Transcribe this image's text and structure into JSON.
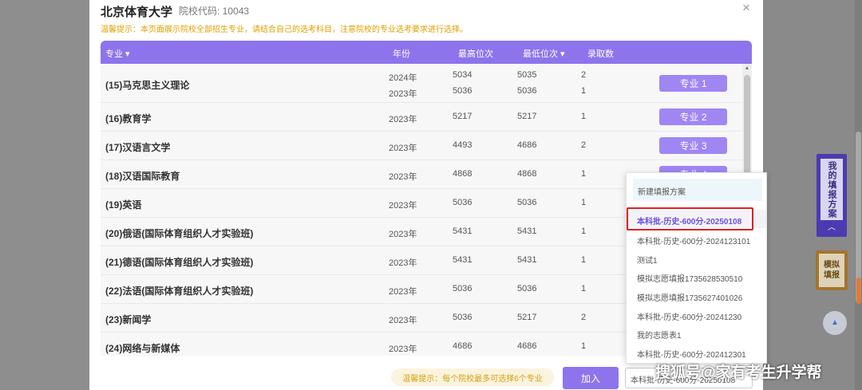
{
  "school": {
    "name": "北京体育大学",
    "code_label": "院校代码: 10043"
  },
  "notice": "温馨提示：本页面展示院校全部招生专业，请结合自己的选考科目，注意院校的专业选考要求进行选择。",
  "close_icon": "×",
  "table": {
    "headers": [
      "专业 ▾",
      "年份",
      "最高位次",
      "最低位次 ▾",
      "录取数"
    ],
    "rows": [
      {
        "major": "(15)马克思主义理论",
        "entries": [
          {
            "year": "2024年",
            "high": "5034",
            "low": "5035",
            "count": "2"
          },
          {
            "year": "2023年",
            "high": "5036",
            "low": "5036",
            "count": "1"
          }
        ],
        "button": "专业 1"
      },
      {
        "major": "(16)教育学",
        "entries": [
          {
            "year": "2023年",
            "high": "5217",
            "low": "5217",
            "count": "1"
          }
        ],
        "button": "专业 2"
      },
      {
        "major": "(17)汉语言文学",
        "entries": [
          {
            "year": "2023年",
            "high": "4493",
            "low": "4686",
            "count": "2"
          }
        ],
        "button": "专业 3"
      },
      {
        "major": "(18)汉语国际教育",
        "entries": [
          {
            "year": "2023年",
            "high": "4868",
            "low": "4868",
            "count": "1"
          }
        ],
        "button": "专业 4"
      },
      {
        "major": "(19)英语",
        "entries": [
          {
            "year": "2023年",
            "high": "5036",
            "low": "5036",
            "count": "1"
          }
        ],
        "button": ""
      },
      {
        "major": "(20)俄语(国际体育组织人才实验班)",
        "entries": [
          {
            "year": "2023年",
            "high": "5431",
            "low": "5431",
            "count": "1"
          }
        ],
        "button": ""
      },
      {
        "major": "(21)德语(国际体育组织人才实验班)",
        "entries": [
          {
            "year": "2023年",
            "high": "5431",
            "low": "5431",
            "count": "1"
          }
        ],
        "button": ""
      },
      {
        "major": "(22)法语(国际体育组织人才实验班)",
        "entries": [
          {
            "year": "2023年",
            "high": "5036",
            "low": "5036",
            "count": "1"
          }
        ],
        "button": ""
      },
      {
        "major": "(23)新闻学",
        "entries": [
          {
            "year": "2023年",
            "high": "5036",
            "low": "5217",
            "count": "2"
          }
        ],
        "button": ""
      },
      {
        "major": "(24)网络与新媒体",
        "entries": [
          {
            "year": "2023年",
            "high": "4686",
            "low": "4686",
            "count": "1"
          }
        ],
        "button": ""
      }
    ]
  },
  "dropdown": {
    "new_plan": "新建填报方案",
    "options": [
      "本科批-历史-600分-20250108",
      "本科批-历史-600分-2024123101",
      "测试1",
      "模拟志愿填报1735628530510",
      "模拟志愿填报1735627401026",
      "本科批-历史-600分-20241230",
      "我的志愿表1",
      "本科批-历史-600分-202412301"
    ],
    "selected_index": 0
  },
  "footer": {
    "tip": "温馨提示：每个院校最多可选择6个专业",
    "add_button": "加入",
    "plan_select_value": "本科批-历史-600分-20250108"
  },
  "side": {
    "my_plan": "我的填报方案",
    "my_plan_arrow": "︿",
    "simulate_line1": "模拟",
    "simulate_line2": "填报",
    "back_to_top": "▲"
  },
  "watermark": "搜狐号@家有考生升学帮",
  "colors": {
    "accent": "#8d74ec",
    "button": "#9f86f3",
    "notice": "#e0a000",
    "highlight": "#e02020",
    "selected_text": "#6b4fe0"
  }
}
